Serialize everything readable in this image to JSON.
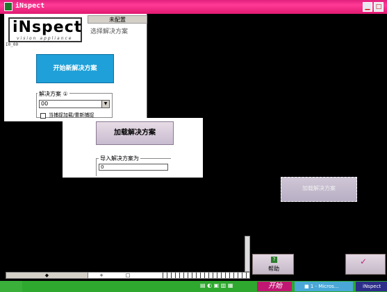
{
  "window": {
    "title": "iNspect",
    "min_glyph": "▁",
    "max_glyph": "□"
  },
  "brand": {
    "logo_text": "iNspect",
    "logo_sub": "vision appliance"
  },
  "config_panel": {
    "tab_label": "未配置",
    "subtitle": "选择解决方案",
    "version_text": "I0_00"
  },
  "new_solution": {
    "label": "开始新解决方案"
  },
  "solution_group": {
    "label": "解决方案 ①",
    "selected": "00",
    "arrow": "▼",
    "checkbox_label": "当捕捉加载/重新捕捉"
  },
  "load_panel": {
    "load_label": "加载解决方案",
    "import_label": "导入解决方案为",
    "import_value": "0"
  },
  "glitch_button": {
    "label": "加载解决方案"
  },
  "help_button": {
    "icon": "?",
    "label": "帮助"
  },
  "ok_button": {
    "icon": "✓"
  },
  "hscroll": {
    "thumb_glyph": "◆",
    "plus_glyph": "+",
    "box_glyph": "□"
  },
  "taskbar": {
    "quick_launch": "▤ ◐ ▣ ▥ ▦",
    "start_label": "开始",
    "task_items": [
      "■ 1 - Micros...",
      "iNspect"
    ]
  },
  "colors": {
    "titlebar": "#e01a70",
    "accent_blue": "#1fa0d8",
    "taskbar": "#2ea82e",
    "start": "#c01872"
  }
}
